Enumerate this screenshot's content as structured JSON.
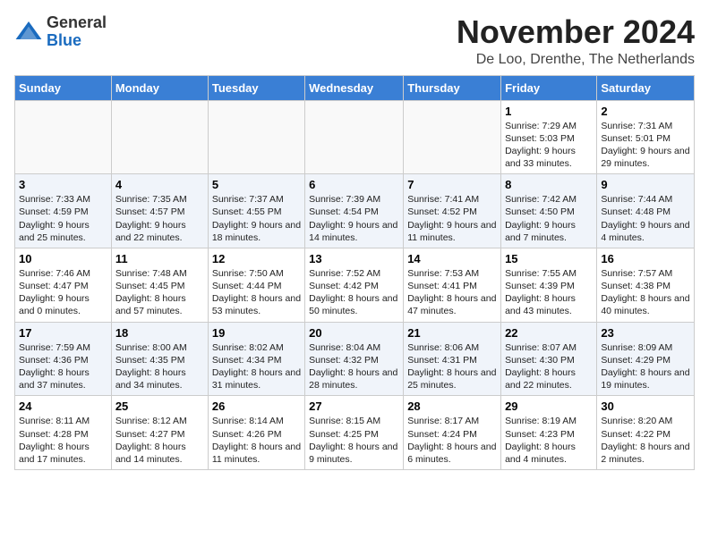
{
  "header": {
    "logo_general": "General",
    "logo_blue": "Blue",
    "month_title": "November 2024",
    "location": "De Loo, Drenthe, The Netherlands"
  },
  "weekdays": [
    "Sunday",
    "Monday",
    "Tuesday",
    "Wednesday",
    "Thursday",
    "Friday",
    "Saturday"
  ],
  "weeks": [
    [
      {
        "day": "",
        "info": ""
      },
      {
        "day": "",
        "info": ""
      },
      {
        "day": "",
        "info": ""
      },
      {
        "day": "",
        "info": ""
      },
      {
        "day": "",
        "info": ""
      },
      {
        "day": "1",
        "info": "Sunrise: 7:29 AM\nSunset: 5:03 PM\nDaylight: 9 hours and 33 minutes."
      },
      {
        "day": "2",
        "info": "Sunrise: 7:31 AM\nSunset: 5:01 PM\nDaylight: 9 hours and 29 minutes."
      }
    ],
    [
      {
        "day": "3",
        "info": "Sunrise: 7:33 AM\nSunset: 4:59 PM\nDaylight: 9 hours and 25 minutes."
      },
      {
        "day": "4",
        "info": "Sunrise: 7:35 AM\nSunset: 4:57 PM\nDaylight: 9 hours and 22 minutes."
      },
      {
        "day": "5",
        "info": "Sunrise: 7:37 AM\nSunset: 4:55 PM\nDaylight: 9 hours and 18 minutes."
      },
      {
        "day": "6",
        "info": "Sunrise: 7:39 AM\nSunset: 4:54 PM\nDaylight: 9 hours and 14 minutes."
      },
      {
        "day": "7",
        "info": "Sunrise: 7:41 AM\nSunset: 4:52 PM\nDaylight: 9 hours and 11 minutes."
      },
      {
        "day": "8",
        "info": "Sunrise: 7:42 AM\nSunset: 4:50 PM\nDaylight: 9 hours and 7 minutes."
      },
      {
        "day": "9",
        "info": "Sunrise: 7:44 AM\nSunset: 4:48 PM\nDaylight: 9 hours and 4 minutes."
      }
    ],
    [
      {
        "day": "10",
        "info": "Sunrise: 7:46 AM\nSunset: 4:47 PM\nDaylight: 9 hours and 0 minutes."
      },
      {
        "day": "11",
        "info": "Sunrise: 7:48 AM\nSunset: 4:45 PM\nDaylight: 8 hours and 57 minutes."
      },
      {
        "day": "12",
        "info": "Sunrise: 7:50 AM\nSunset: 4:44 PM\nDaylight: 8 hours and 53 minutes."
      },
      {
        "day": "13",
        "info": "Sunrise: 7:52 AM\nSunset: 4:42 PM\nDaylight: 8 hours and 50 minutes."
      },
      {
        "day": "14",
        "info": "Sunrise: 7:53 AM\nSunset: 4:41 PM\nDaylight: 8 hours and 47 minutes."
      },
      {
        "day": "15",
        "info": "Sunrise: 7:55 AM\nSunset: 4:39 PM\nDaylight: 8 hours and 43 minutes."
      },
      {
        "day": "16",
        "info": "Sunrise: 7:57 AM\nSunset: 4:38 PM\nDaylight: 8 hours and 40 minutes."
      }
    ],
    [
      {
        "day": "17",
        "info": "Sunrise: 7:59 AM\nSunset: 4:36 PM\nDaylight: 8 hours and 37 minutes."
      },
      {
        "day": "18",
        "info": "Sunrise: 8:00 AM\nSunset: 4:35 PM\nDaylight: 8 hours and 34 minutes."
      },
      {
        "day": "19",
        "info": "Sunrise: 8:02 AM\nSunset: 4:34 PM\nDaylight: 8 hours and 31 minutes."
      },
      {
        "day": "20",
        "info": "Sunrise: 8:04 AM\nSunset: 4:32 PM\nDaylight: 8 hours and 28 minutes."
      },
      {
        "day": "21",
        "info": "Sunrise: 8:06 AM\nSunset: 4:31 PM\nDaylight: 8 hours and 25 minutes."
      },
      {
        "day": "22",
        "info": "Sunrise: 8:07 AM\nSunset: 4:30 PM\nDaylight: 8 hours and 22 minutes."
      },
      {
        "day": "23",
        "info": "Sunrise: 8:09 AM\nSunset: 4:29 PM\nDaylight: 8 hours and 19 minutes."
      }
    ],
    [
      {
        "day": "24",
        "info": "Sunrise: 8:11 AM\nSunset: 4:28 PM\nDaylight: 8 hours and 17 minutes."
      },
      {
        "day": "25",
        "info": "Sunrise: 8:12 AM\nSunset: 4:27 PM\nDaylight: 8 hours and 14 minutes."
      },
      {
        "day": "26",
        "info": "Sunrise: 8:14 AM\nSunset: 4:26 PM\nDaylight: 8 hours and 11 minutes."
      },
      {
        "day": "27",
        "info": "Sunrise: 8:15 AM\nSunset: 4:25 PM\nDaylight: 8 hours and 9 minutes."
      },
      {
        "day": "28",
        "info": "Sunrise: 8:17 AM\nSunset: 4:24 PM\nDaylight: 8 hours and 6 minutes."
      },
      {
        "day": "29",
        "info": "Sunrise: 8:19 AM\nSunset: 4:23 PM\nDaylight: 8 hours and 4 minutes."
      },
      {
        "day": "30",
        "info": "Sunrise: 8:20 AM\nSunset: 4:22 PM\nDaylight: 8 hours and 2 minutes."
      }
    ]
  ]
}
